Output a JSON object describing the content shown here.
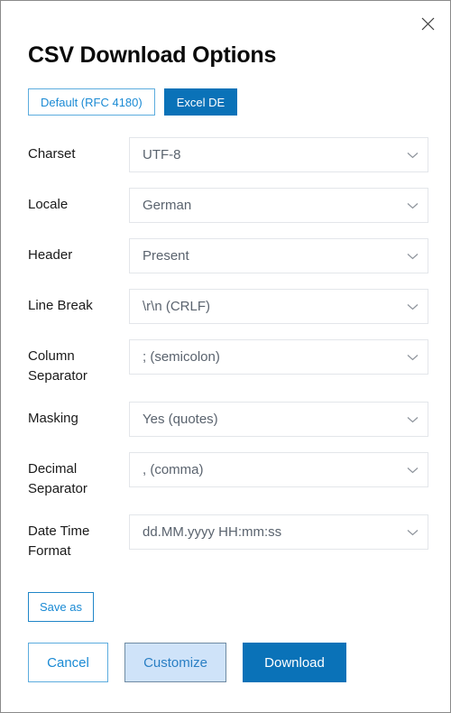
{
  "dialog": {
    "title": "CSV Download Options",
    "close_icon": "close-icon",
    "close_label": "Close"
  },
  "presets": [
    {
      "label": "Default (RFC 4180)",
      "style": "outline",
      "selected": false
    },
    {
      "label": "Excel DE",
      "style": "solid",
      "selected": true
    }
  ],
  "fields": [
    {
      "label": "Charset",
      "value": "UTF-8"
    },
    {
      "label": "Locale",
      "value": "German"
    },
    {
      "label": "Header",
      "value": "Present"
    },
    {
      "label": "Line Break",
      "value": "\\r\\n (CRLF)"
    },
    {
      "label": "Column Separator",
      "value": "; (semicolon)"
    },
    {
      "label": "Masking",
      "value": "Yes (quotes)"
    },
    {
      "label": "Decimal Separator",
      "value": ", (comma)"
    },
    {
      "label": "Date Time Format",
      "value": "dd.MM.yyyy HH:mm:ss"
    }
  ],
  "save_as": {
    "label": "Save as"
  },
  "footer": {
    "cancel_label": "Cancel",
    "customize_label": "Customize",
    "download_label": "Download"
  },
  "colors": {
    "accent_blue": "#0a72b8",
    "link_blue": "#1a8ad4",
    "light_blue_fill": "#cfe3f9",
    "field_border": "#e3e6ea",
    "value_text": "#5a636e",
    "label_text": "#1a1a1a",
    "dialog_border": "#8a8a8a"
  }
}
